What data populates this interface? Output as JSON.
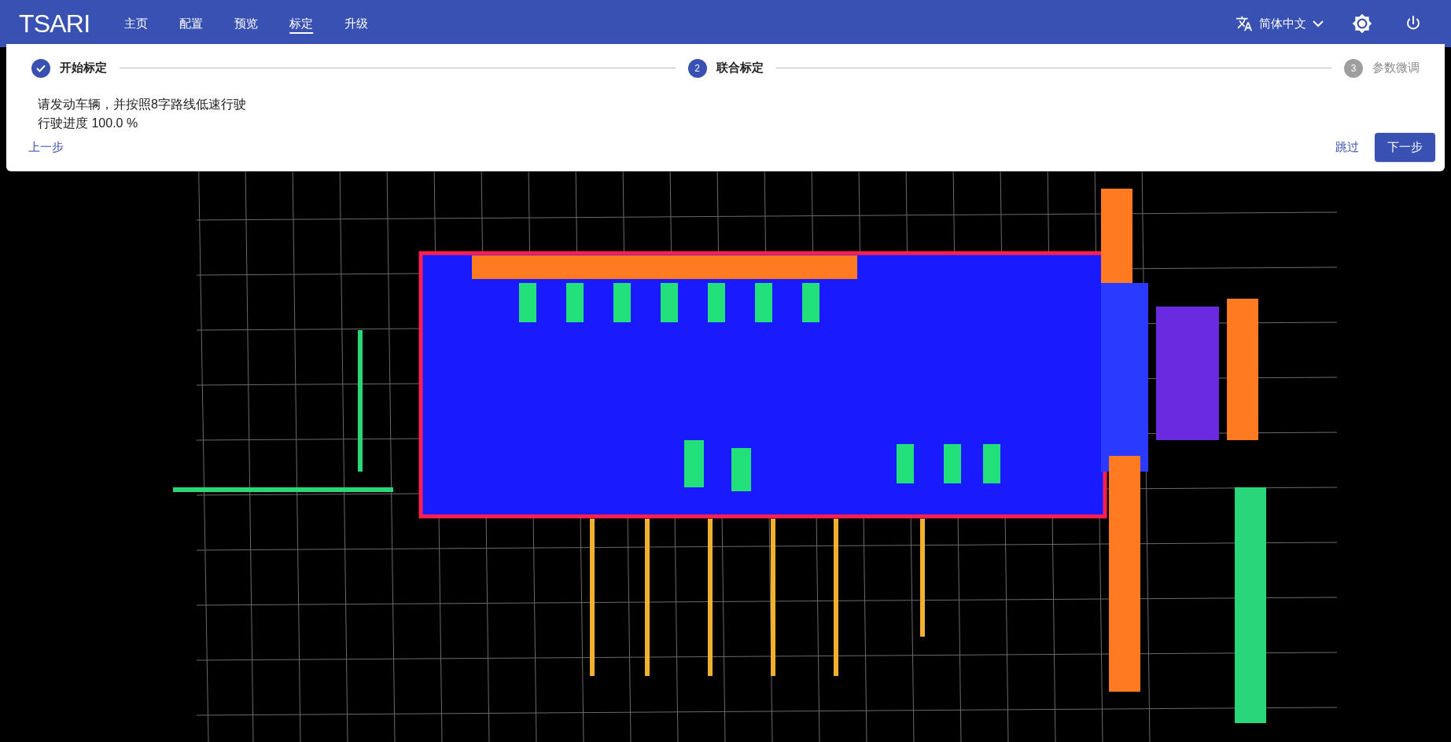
{
  "app": {
    "logo": "TSARI"
  },
  "nav": [
    {
      "label": "主页",
      "selected": false
    },
    {
      "label": "配置",
      "selected": false
    },
    {
      "label": "预览",
      "selected": false
    },
    {
      "label": "标定",
      "selected": true
    },
    {
      "label": "升级",
      "selected": false
    }
  ],
  "language": {
    "label": "简体中文"
  },
  "stepper": [
    {
      "label": "开始标定",
      "completed": true
    },
    {
      "number": "2",
      "label": "联合标定",
      "completed": false,
      "active": true
    },
    {
      "number": "3",
      "label": "参数微调",
      "completed": false,
      "active": false
    }
  ],
  "instructions": [
    "请发动车辆，并按照8字路线低速行驶",
    "行驶进度 100.0 %"
  ],
  "buttons": {
    "back": "上一步",
    "skip": "跳过",
    "next": "下一步"
  }
}
